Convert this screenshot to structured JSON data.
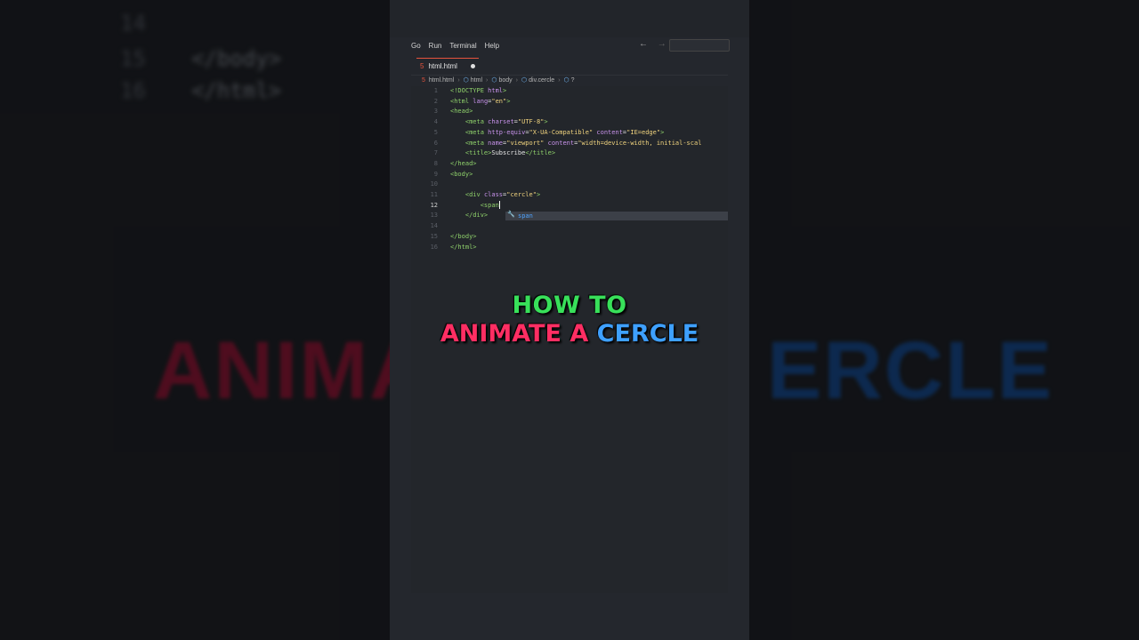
{
  "background": {
    "ghost_lines": [
      {
        "num": "14",
        "code": ""
      },
      {
        "num": "15",
        "code": "</body>"
      },
      {
        "num": "16",
        "code": "</html>"
      }
    ],
    "big_words": {
      "left": "ANIMA",
      "right": "ERCLE"
    }
  },
  "menu": {
    "items": [
      "Go",
      "Run",
      "Terminal",
      "Help"
    ],
    "back_glyph": "←",
    "forward_glyph": "→"
  },
  "tab": {
    "filename": "html.html",
    "icon": "html-file-icon"
  },
  "breadcrumb": {
    "file": "html.html",
    "parts": [
      "html",
      "body",
      "div.cercle",
      "?"
    ]
  },
  "editor": {
    "active_line": 12,
    "lines": [
      {
        "n": "1",
        "html": "<span class=\"tag\">&lt;!DOCTYPE</span> <span class=\"attr\">html</span><span class=\"tag\">&gt;</span>"
      },
      {
        "n": "2",
        "html": "<span class=\"tag\">&lt;html</span> <span class=\"attr\">lang</span><span class=\"txt\">=</span><span class=\"str\">\"en\"</span><span class=\"tag\">&gt;</span>"
      },
      {
        "n": "3",
        "html": "<span class=\"tag\">&lt;head&gt;</span>"
      },
      {
        "n": "4",
        "html": "    <span class=\"tag\">&lt;meta</span> <span class=\"attr\">charset</span><span class=\"txt\">=</span><span class=\"str\">\"UTF-8\"</span><span class=\"tag\">&gt;</span>"
      },
      {
        "n": "5",
        "html": "    <span class=\"tag\">&lt;meta</span> <span class=\"attr\">http-equiv</span><span class=\"txt\">=</span><span class=\"str\">\"X-UA-Compatible\"</span> <span class=\"attr\">content</span><span class=\"txt\">=</span><span class=\"str\">\"IE=edge\"</span><span class=\"tag\">&gt;</span>"
      },
      {
        "n": "6",
        "html": "    <span class=\"tag\">&lt;meta</span> <span class=\"attr\">name</span><span class=\"txt\">=</span><span class=\"str\">\"viewport\"</span> <span class=\"attr\">content</span><span class=\"txt\">=</span><span class=\"str\">\"width=device-width, initial-scal</span>"
      },
      {
        "n": "7",
        "html": "    <span class=\"tag\">&lt;title&gt;</span><span class=\"txt\">Subscribe</span><span class=\"tag\">&lt;/title&gt;</span>"
      },
      {
        "n": "8",
        "html": "<span class=\"tag\">&lt;/head&gt;</span>"
      },
      {
        "n": "9",
        "html": "<span class=\"tag\">&lt;body&gt;</span>"
      },
      {
        "n": "10",
        "html": ""
      },
      {
        "n": "11",
        "html": "    <span class=\"tag\">&lt;div</span> <span class=\"attr\">class</span><span class=\"txt\">=</span><span class=\"str\">\"cercle\"</span><span class=\"tag\">&gt;</span>"
      },
      {
        "n": "12",
        "html": "        <span class=\"tag\">&lt;span</span><span class=\"cursor\"></span>"
      },
      {
        "n": "13",
        "html": "    <span class=\"tag\">&lt;/div&gt;</span>"
      },
      {
        "n": "14",
        "html": ""
      },
      {
        "n": "15",
        "html": "<span class=\"tag\">&lt;/body&gt;</span>"
      },
      {
        "n": "16",
        "html": "<span class=\"tag\">&lt;/html&gt;</span>"
      }
    ],
    "suggestion": {
      "label": "span",
      "icon": "wrench-icon"
    }
  },
  "caption": {
    "line1": "HOW TO",
    "line2_w1": "ANIMATE",
    "line2_w2": "A",
    "line2_w3": "CERCLE"
  },
  "colors": {
    "panel_bg": "#24272d",
    "caption_green": "#38e05a",
    "caption_pink": "#ff2e63",
    "caption_blue": "#3ea0ff",
    "tag_green": "#8fd16b",
    "attr_purple": "#c792ea",
    "string_yellow": "#f0d37e"
  }
}
